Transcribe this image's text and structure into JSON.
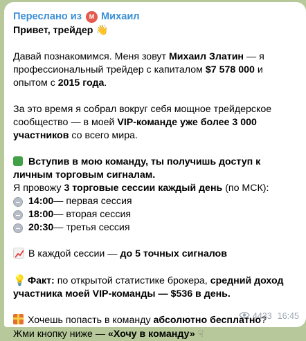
{
  "forward": {
    "prefix": "Переслано из",
    "avatar_letter": "М",
    "name": "Михаил"
  },
  "greeting": "Привет, трейдер",
  "intro": {
    "p1": "Давай познакомимся. Меня зовут",
    "name": "Михаил Златин",
    "p2": " — я профессиональный трейдер с капиталом",
    "capital": "$7 578 000",
    "p3": " и опытом с",
    "year": "2015 года",
    "p4": "."
  },
  "community": {
    "p1": "За это время я собрал вокруг себя мощное трейдерское сообщество — в моей",
    "bold": "VIP-команде уже более 3 000 участников",
    "p2": " со всего мира."
  },
  "join": {
    "bold": "Вступив в мою команду, ты получишь доступ к личным торговым сигналам."
  },
  "schedule": {
    "p1": "Я провожу",
    "bold": "3 торговые сессии каждый день",
    "p2": " (по МСК):"
  },
  "sessions": [
    {
      "time": "14:00",
      "label": " — первая сессия"
    },
    {
      "time": "18:00",
      "label": " — вторая сессия"
    },
    {
      "time": "20:30",
      "label": " — третья сессия"
    }
  ],
  "signals": {
    "p1": "В каждой сессии —",
    "bold": "до 5 точных сигналов"
  },
  "fact": {
    "label": "Факт:",
    "p1": " по открытой статистике брокера,",
    "bold": "средний доход участника моей VIP-команды — $536 в день."
  },
  "cta": {
    "p1": "Хочешь попасть в команду",
    "bold1": "абсолютно бесплатно",
    "p2": "?",
    "p3": "Жми кнопку ниже —",
    "bold2": "«Хочу в команду»"
  },
  "meta": {
    "views": "4433",
    "time": "16:45"
  }
}
